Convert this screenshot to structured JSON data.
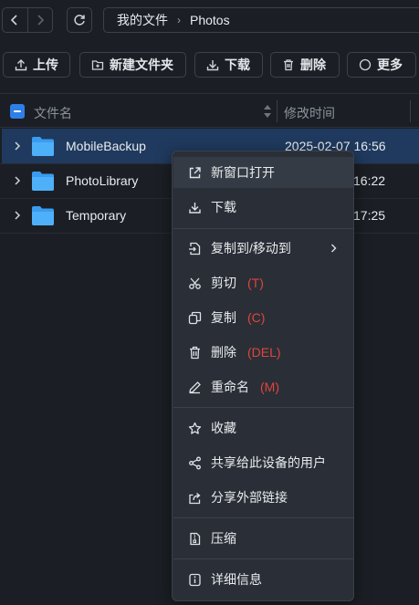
{
  "nav": {
    "back_icon": "chevron-left-icon",
    "forward_icon": "chevron-right-icon",
    "refresh_icon": "refresh-icon"
  },
  "breadcrumb": {
    "root": "我的文件",
    "current": "Photos"
  },
  "toolbar": {
    "upload": "上传",
    "new_folder": "新建文件夹",
    "download": "下载",
    "delete": "删除",
    "more": "更多"
  },
  "table": {
    "col_name": "文件名",
    "col_time": "修改时间",
    "rows": [
      {
        "name": "MobileBackup",
        "time": "2025-02-07 16:56"
      },
      {
        "name": "PhotoLibrary",
        "time": "16:22"
      },
      {
        "name": "Temporary",
        "time": "17:25"
      }
    ]
  },
  "menu": {
    "open_new_window": "新窗口打开",
    "download": "下载",
    "copy_move_to": "复制到/移动到",
    "cut": "剪切",
    "cut_key": "(T)",
    "copy": "复制",
    "copy_key": "(C)",
    "delete": "删除",
    "delete_key": "(DEL)",
    "rename": "重命名",
    "rename_key": "(M)",
    "favorite": "收藏",
    "share_device_users": "共享给此设备的用户",
    "share_external_link": "分享外部链接",
    "compress": "压缩",
    "details": "详细信息"
  },
  "colors": {
    "accent": "#2f7fe8",
    "shortcut": "#e0443c",
    "selected_row": "#1f3a5e",
    "background": "#1b1f25"
  }
}
